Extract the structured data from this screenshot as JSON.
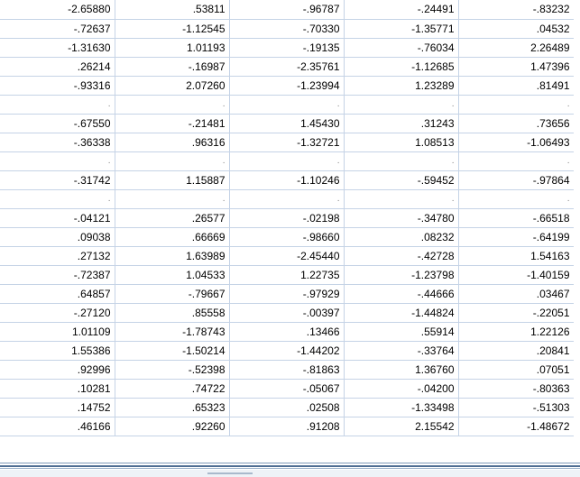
{
  "rows": [
    [
      "-2.65880",
      ".53811",
      "-.96787",
      "-.24491",
      "-.83232"
    ],
    [
      "-.72637",
      "-1.12545",
      "-.70330",
      "-1.35771",
      ".04532"
    ],
    [
      "-1.31630",
      "1.01193",
      "-.19135",
      "-.76034",
      "2.26489"
    ],
    [
      ".26214",
      "-.16987",
      "-2.35761",
      "-1.12685",
      "1.47396"
    ],
    [
      "-.93316",
      "2.07260",
      "-1.23994",
      "1.23289",
      ".81491"
    ],
    [
      ".",
      ".",
      ".",
      ".",
      "."
    ],
    [
      "-.67550",
      "-.21481",
      "1.45430",
      ".31243",
      ".73656"
    ],
    [
      "-.36338",
      ".96316",
      "-1.32721",
      "1.08513",
      "-1.06493"
    ],
    [
      ".",
      ".",
      ".",
      ".",
      "."
    ],
    [
      "-.31742",
      "1.15887",
      "-1.10246",
      "-.59452",
      "-.97864"
    ],
    [
      ".",
      ".",
      ".",
      ".",
      "."
    ],
    [
      "-.04121",
      ".26577",
      "-.02198",
      "-.34780",
      "-.66518"
    ],
    [
      ".09038",
      ".66669",
      "-.98660",
      ".08232",
      "-.64199"
    ],
    [
      ".27132",
      "1.63989",
      "-2.45440",
      "-.42728",
      "1.54163"
    ],
    [
      "-.72387",
      "1.04533",
      "1.22735",
      "-1.23798",
      "-1.40159"
    ],
    [
      ".64857",
      "-.79667",
      "-.97929",
      "-.44666",
      ".03467"
    ],
    [
      "-.27120",
      ".85558",
      "-.00397",
      "-1.44824",
      "-.22051"
    ],
    [
      "1.01109",
      "-1.78743",
      ".13466",
      ".55914",
      "1.22126"
    ],
    [
      "1.55386",
      "-1.50214",
      "-1.44202",
      "-.33764",
      ".20841"
    ],
    [
      ".92996",
      "-.52398",
      "-.81863",
      "1.36760",
      ".07051"
    ],
    [
      ".10281",
      ".74722",
      "-.05067",
      "-.04200",
      "-.80363"
    ],
    [
      ".14752",
      ".65323",
      ".02508",
      "-1.33498",
      "-.51303"
    ],
    [
      ".46166",
      ".92260",
      ".91208",
      "2.15542",
      "-1.48672"
    ]
  ]
}
